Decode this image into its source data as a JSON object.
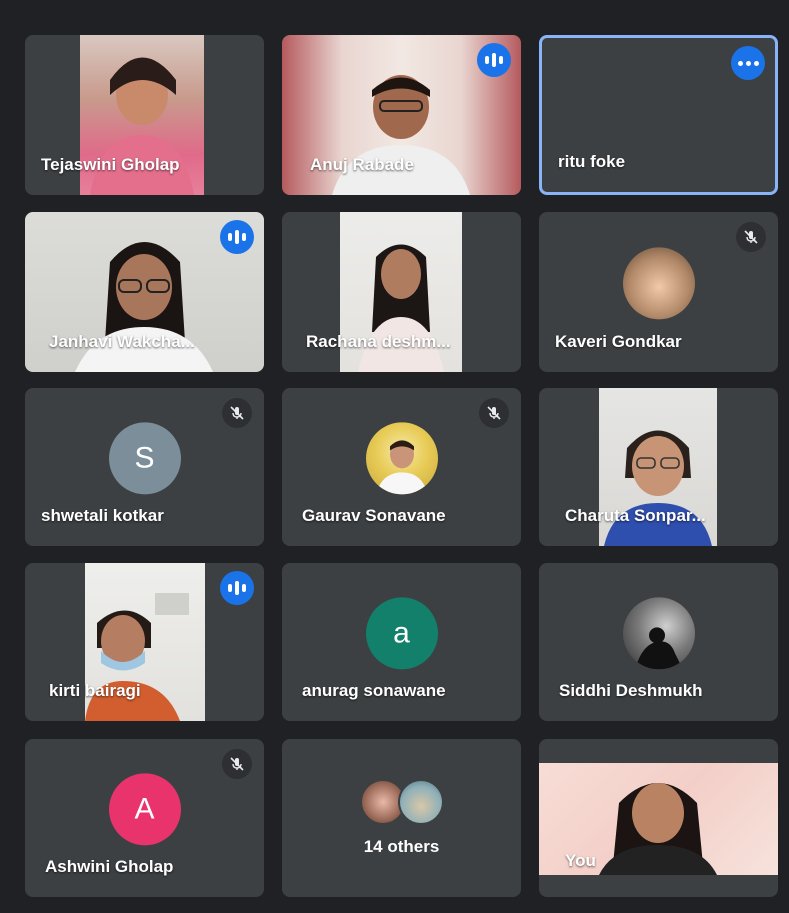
{
  "meeting": {
    "participants": [
      {
        "name": "Tejaswini Gholap"
      },
      {
        "name": "Anuj Rabade"
      },
      {
        "name": "ritu foke"
      },
      {
        "name": "Janhavi Wakcha..."
      },
      {
        "name": "Rachana deshm..."
      },
      {
        "name": "Kaveri Gondkar"
      },
      {
        "name": "shwetali kotkar",
        "initial": "S"
      },
      {
        "name": "Gaurav Sonavane"
      },
      {
        "name": "Charuta Sonpar..."
      },
      {
        "name": "kirti bairagi"
      },
      {
        "name": "anurag sonawane",
        "initial": "a"
      },
      {
        "name": "Siddhi Deshmukh"
      },
      {
        "name": "Ashwini Gholap",
        "initial": "A"
      },
      {
        "name": "14 others"
      },
      {
        "name": "You"
      }
    ]
  },
  "colors": {
    "background": "#202124",
    "tile": "#3c4043",
    "accent_blue": "#1a73e8",
    "active_border": "#8ab4f8",
    "avatar_grey": "#7b8e99",
    "avatar_teal": "#12806b",
    "avatar_pink": "#e8336d"
  }
}
